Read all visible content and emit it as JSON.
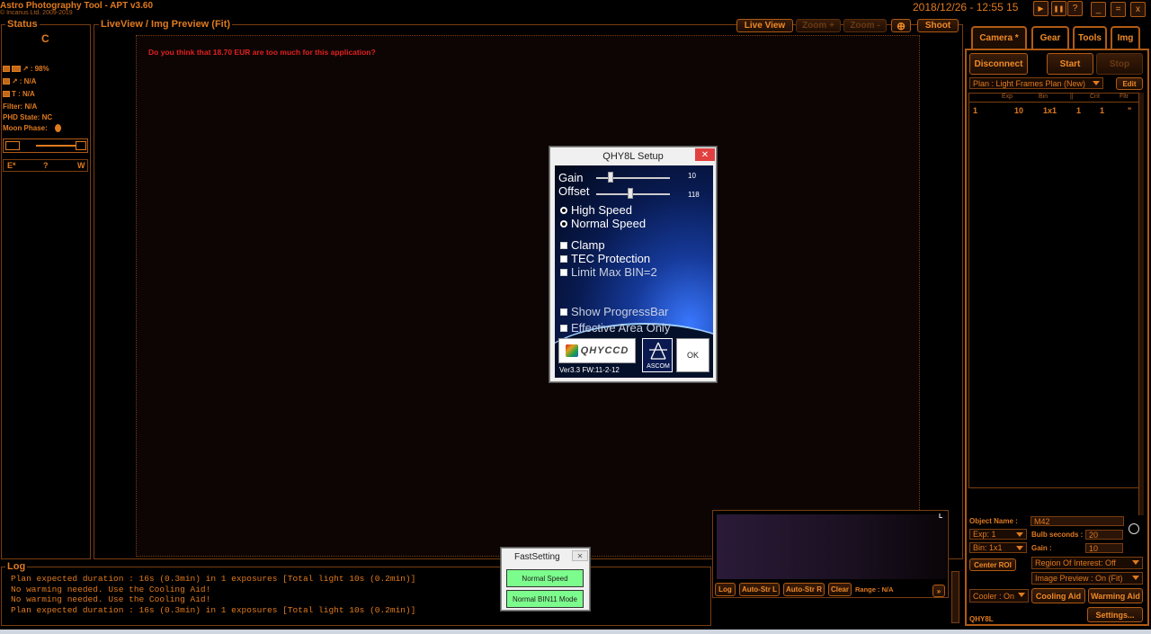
{
  "app": {
    "title": "Astro Photography Tool  -  APT v3.60",
    "copyright": "© Incanus Ltd. 2009-2019",
    "datetime": "2018/12/26 - 12:55 15"
  },
  "window_controls": {
    "play": "▶",
    "pause": "❚❚",
    "help": "?",
    "minimize": "_",
    "maximize": "=",
    "close": "x"
  },
  "status": {
    "title": "Status",
    "letter": "C",
    "battery": ": 98%",
    "focus": ": N/A",
    "temp": "T : N/A",
    "filter": "Filter: N/A",
    "phd": "PHD State: NC",
    "moon": "Moon Phase:",
    "nav": [
      "E*",
      "?",
      "W"
    ]
  },
  "liveview": {
    "title": "LiveView / Img Preview (Fit)",
    "message": "Do you think that 18.70 EUR are too much for this application?",
    "buttons": {
      "live": "Live View",
      "zoom_in": "Zoom +",
      "zoom_out": "Zoom -",
      "crosshair": "⊕",
      "shoot": "Shoot"
    }
  },
  "tabs": [
    "Camera *",
    "Gear",
    "Tools",
    "Img"
  ],
  "camera": {
    "disconnect": "Disconnect",
    "start": "Start",
    "stop": "Stop",
    "plan": "Plan : Light Frames Plan (New)",
    "edit": "Edit",
    "table_headers": [
      "",
      "Exp",
      "Bin",
      "||",
      "Cnt",
      "Fltr"
    ],
    "table_rows": [
      [
        "1",
        "10",
        "1x1",
        "1",
        "1",
        "\""
      ]
    ],
    "object_label": "Object Name :",
    "object_value": "M42",
    "exp": "Exp: 1",
    "bulb_label": "Bulb seconds :",
    "bulb_value": "20",
    "bin": "Bin: 1x1",
    "gain_label": "Gain :",
    "gain_value": "10",
    "center_roi": "Center ROI",
    "roi": "Region Of Interest: Off",
    "preview": "Image Preview : On (Fit)",
    "cooler": "Cooler : On",
    "cooling_aid": "Cooling Aid",
    "warming_aid": "Warming Aid",
    "camera_name": "QHY8L",
    "settings": "Settings..."
  },
  "histogram": {
    "corner": "L",
    "log": "Log",
    "auto_l": "Auto-Str L",
    "auto_r": "Auto-Str R",
    "clear": "Clear",
    "range": "Range : N/A"
  },
  "log": {
    "title": "Log",
    "lines": [
      "Plan expected duration : 16s (0.3min) in 1 exposures [Total light 10s (0.2min)]",
      "No warming needed. Use the Cooling Aid!",
      "No warming needed. Use the Cooling Aid!",
      "Plan expected duration : 16s (0.3min) in 1 exposures [Total light 10s (0.2min)]"
    ]
  },
  "qhy_dialog": {
    "title": "QHY8L Setup",
    "gain_label": "Gain",
    "gain_value": "10",
    "gain_level": 0.2,
    "offset_label": "Offset",
    "offset_value": "118",
    "offset_level": 0.46,
    "high_speed": "High Speed",
    "normal_speed": "Normal Speed",
    "clamp": "Clamp",
    "tec": "TEC Protection",
    "limit_bin": "Limit Max BIN=2",
    "show_progress": "Show ProgressBar",
    "effective_area": "Effective Area Only",
    "logo": "QHYCCD",
    "ascom": "ASCOM",
    "ok": "OK",
    "version": "Ver3.3 FW:11-2-12"
  },
  "fast_setting": {
    "title": "FastSetting",
    "normal_speed": "Normal Speed",
    "normal_bin": "Normal BIN11 Mode"
  }
}
